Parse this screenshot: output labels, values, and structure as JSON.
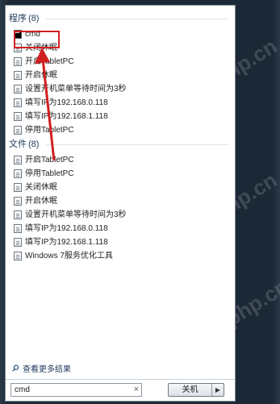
{
  "programs": {
    "header": "程序",
    "count": "(8)",
    "items": [
      {
        "label": "cmd"
      },
      {
        "label": "关闭休眠"
      },
      {
        "label": "开启TabletPC"
      },
      {
        "label": "开启休眠"
      },
      {
        "label": "设置开机菜单等待时间为3秒"
      },
      {
        "label": "填写IP为192.168.0.118"
      },
      {
        "label": "填写IP为192.168.1.118"
      },
      {
        "label": "停用TabletPC"
      }
    ]
  },
  "files": {
    "header": "文件",
    "count": "(8)",
    "items": [
      {
        "label": "开启TabletPC"
      },
      {
        "label": "停用TabletPC"
      },
      {
        "label": "关闭休眠"
      },
      {
        "label": "开启休眠"
      },
      {
        "label": "设置开机菜单等待时间为3秒"
      },
      {
        "label": "填写IP为192.168.0.118"
      },
      {
        "label": "填写IP为192.168.1.118"
      },
      {
        "label": "Windows 7服务优化工具"
      }
    ]
  },
  "see_more": "查看更多结果",
  "search": {
    "value": "cmd",
    "clear": "×"
  },
  "shutdown": {
    "label": "关机",
    "arrow": "▶"
  },
  "watermark": "php.cn",
  "annotation_color": "#d11f1f"
}
